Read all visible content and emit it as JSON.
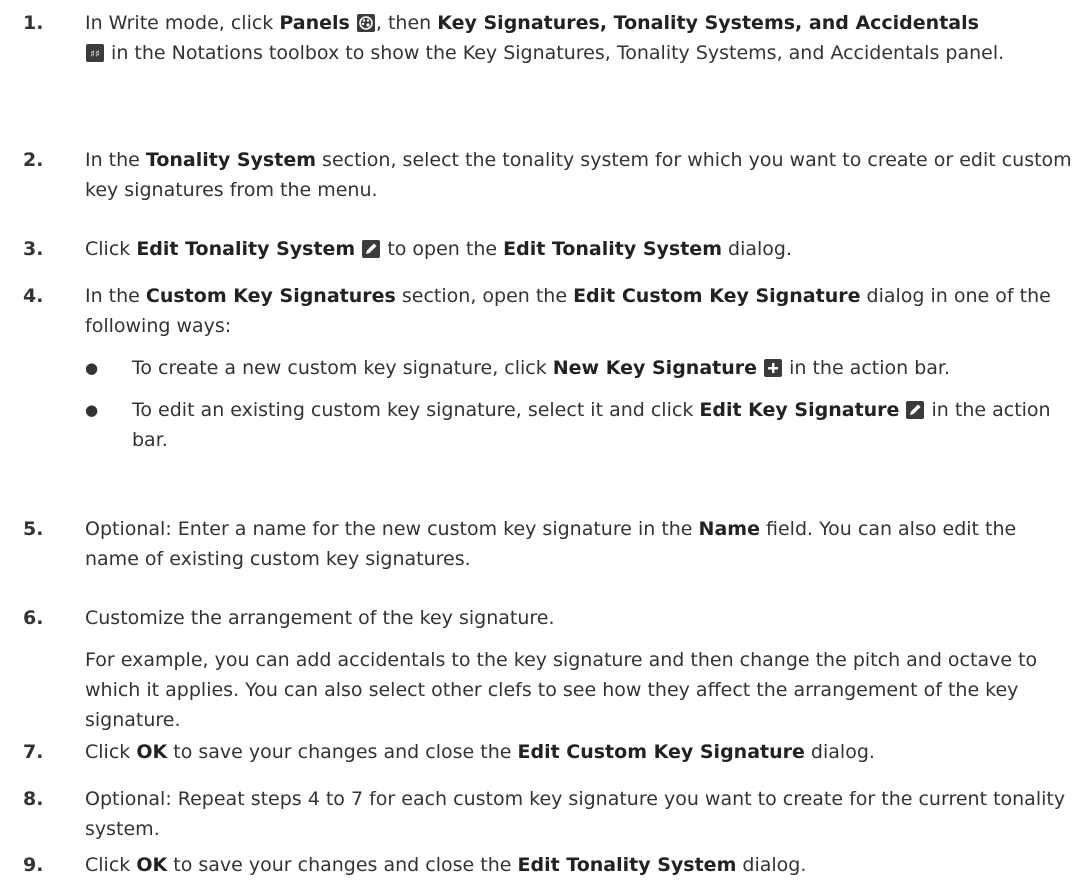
{
  "steps": [
    {
      "num": "1.",
      "parts": {
        "a": "In Write mode, click ",
        "b1": "Panels",
        "c": ", then ",
        "b2": "Key Signatures, Tonality Systems, and Accidentals",
        "d": " in the Notations toolbox to show the Key Signatures, Tonality Systems, and Accidentals panel."
      }
    },
    {
      "num": "2.",
      "parts": {
        "a": "In the ",
        "b1": "Tonality System",
        "c": " section, select the tonality system for which you want to create or edit custom key signatures from the menu."
      }
    },
    {
      "num": "3.",
      "parts": {
        "a": "Click ",
        "b1": "Edit Tonality System",
        "c": " to open the ",
        "b2": "Edit Tonality System",
        "d": " dialog."
      }
    },
    {
      "num": "4.",
      "parts": {
        "a": "In the ",
        "b1": "Custom Key Signatures",
        "c": " section, open the ",
        "b2": "Edit Custom Key Signature",
        "d": " dialog in one of the following ways:"
      },
      "bullets": [
        {
          "a": "To create a new custom key signature, click ",
          "b": "New Key Signature",
          "c": " in the action bar."
        },
        {
          "a": "To edit an existing custom key signature, select it and click ",
          "b": "Edit Key Signature",
          "c": " in the action bar."
        }
      ]
    },
    {
      "num": "5.",
      "parts": {
        "a": "Optional: Enter a name for the new custom key signature in the ",
        "b1": "Name",
        "c": " field. You can also edit the name of existing custom key signatures."
      }
    },
    {
      "num": "6.",
      "parts": {
        "a": "Customize the arrangement of the key signature.",
        "p2": "For example, you can add accidentals to the key signature and then change the pitch and octave to which it applies. You can also select other clefs to see how they affect the arrangement of the key signature."
      }
    },
    {
      "num": "7.",
      "parts": {
        "a": "Click ",
        "b1": "OK",
        "c": " to save your changes and close the ",
        "b2": "Edit Custom Key Signature",
        "d": " dialog."
      }
    },
    {
      "num": "8.",
      "parts": {
        "a": "Optional: Repeat steps 4 to 7 for each custom key signature you want to create for the current tonality system."
      }
    },
    {
      "num": "9.",
      "parts": {
        "a": "Click ",
        "b1": "OK",
        "c": " to save your changes and close the ",
        "b2": "Edit Tonality System",
        "d": " dialog."
      }
    }
  ],
  "icons": {
    "panels": "palette-icon",
    "key_signatures": "sharp-accidentals-icon",
    "edit": "pencil-icon",
    "new": "plus-icon"
  },
  "colors": {
    "text": "#333333",
    "icon_bg": "#3b3b3b"
  }
}
